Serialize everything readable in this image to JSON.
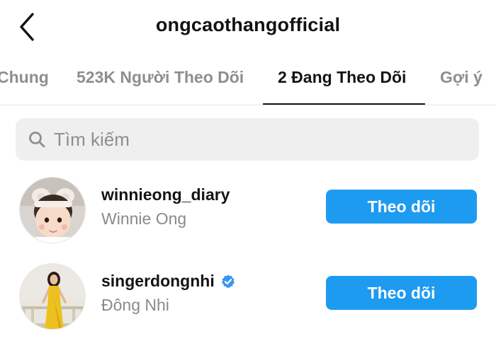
{
  "header": {
    "title": "ongcaothangofficial",
    "back_icon": "chevron-left-icon"
  },
  "tabs": [
    {
      "label": "Chung",
      "active": false
    },
    {
      "label": "523K Người Theo Dõi",
      "active": false
    },
    {
      "label": "2 Đang Theo Dõi",
      "active": true
    },
    {
      "label": "Gợi ý",
      "active": false
    }
  ],
  "search": {
    "placeholder": "Tìm kiếm",
    "value": "",
    "icon": "search-icon"
  },
  "users": [
    {
      "username": "winnieong_diary",
      "full_name": "Winnie Ong",
      "verified": false,
      "button_label": "Theo dõi"
    },
    {
      "username": "singerdongnhi",
      "full_name": "Đông Nhi",
      "verified": true,
      "button_label": "Theo dõi"
    }
  ],
  "colors": {
    "accent": "#1d9bf0",
    "verified": "#3897f0",
    "inactive_tab": "#8e8e8e",
    "search_bg": "#efefef"
  }
}
